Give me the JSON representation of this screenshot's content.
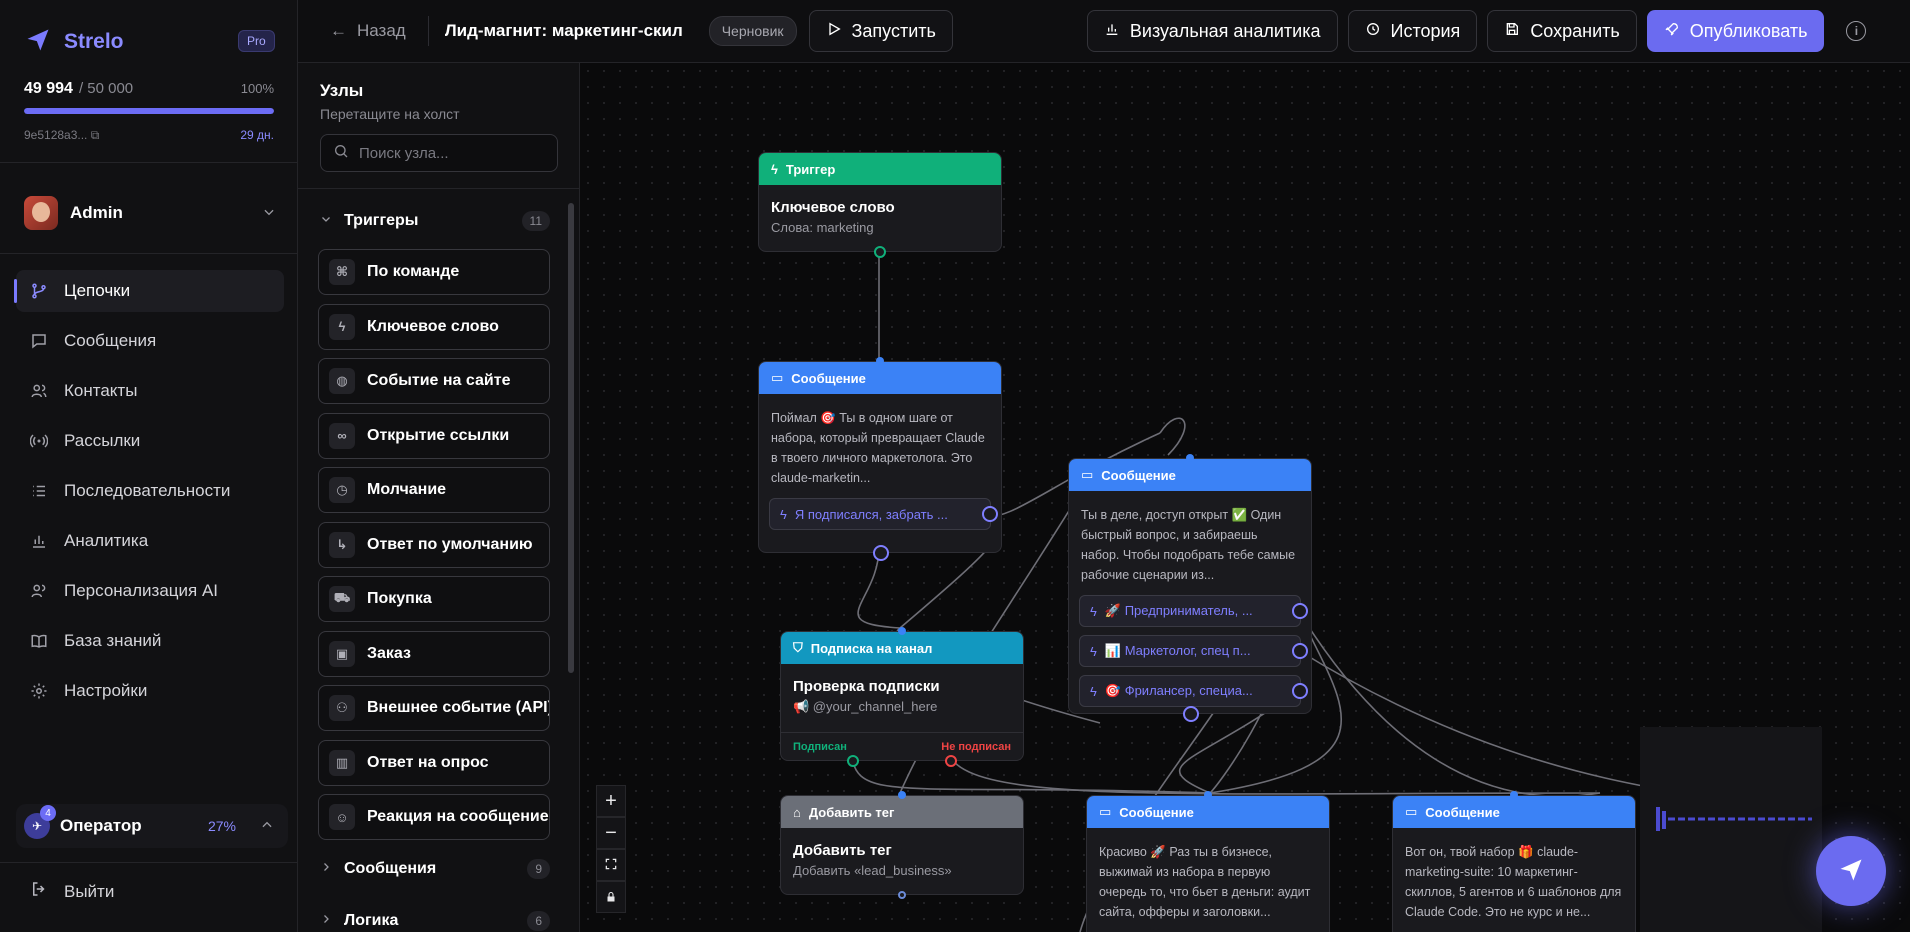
{
  "brand": {
    "name": "Strelo",
    "plan": "Pro"
  },
  "credits": {
    "used": "49 994",
    "max": "/ 50 000",
    "percent": "100%",
    "fill": 0.9999,
    "token": "9e5128a3...",
    "days": "29 дн."
  },
  "user": {
    "name": "Admin"
  },
  "nav": [
    {
      "label": "Цепочки",
      "icon": "branch-icon",
      "active": true
    },
    {
      "label": "Сообщения",
      "icon": "chat-icon"
    },
    {
      "label": "Контакты",
      "icon": "users-icon"
    },
    {
      "label": "Рассылки",
      "icon": "broadcast-icon"
    },
    {
      "label": "Последовательности",
      "icon": "list-icon"
    },
    {
      "label": "Аналитика",
      "icon": "bar-chart-icon"
    },
    {
      "label": "Персонализация AI",
      "icon": "user-ai-icon"
    },
    {
      "label": "База знаний",
      "icon": "book-icon"
    },
    {
      "label": "Настройки",
      "icon": "gear-icon"
    }
  ],
  "operator": {
    "label": "Оператор",
    "badge": "4",
    "percent": "27%"
  },
  "logout": "Выйти",
  "topbar": {
    "back": "Назад",
    "title": "Лид-магнит: маркетинг-скил",
    "status": "Черновик",
    "run": "Запустить",
    "analytics": "Визуальная аналитика",
    "history": "История",
    "save": "Сохранить",
    "publish": "Опубликовать"
  },
  "panel": {
    "title": "Узлы",
    "subtitle": "Перетащите на холст",
    "search_placeholder": "Поиск узла...",
    "groups": [
      {
        "label": "Триггеры",
        "count": "11",
        "expanded": true
      },
      {
        "label": "Сообщения",
        "count": "9"
      },
      {
        "label": "Логика",
        "count": "6"
      }
    ],
    "trigger_nodes": [
      {
        "label": "По команде",
        "icon": "command-icon"
      },
      {
        "label": "Ключевое слово",
        "icon": "bolt-icon"
      },
      {
        "label": "Событие на сайте",
        "icon": "globe-icon"
      },
      {
        "label": "Открытие ссылки",
        "icon": "link-icon"
      },
      {
        "label": "Молчание",
        "icon": "clock-icon"
      },
      {
        "label": "Ответ по умолчанию",
        "icon": "reply-icon"
      },
      {
        "label": "Покупка",
        "icon": "cart-icon"
      },
      {
        "label": "Заказ",
        "icon": "box-icon"
      },
      {
        "label": "Внешнее событие (API)",
        "icon": "webhook-icon"
      },
      {
        "label": "Ответ на опрос",
        "icon": "poll-icon"
      },
      {
        "label": "Реакция на сообщение",
        "icon": "smile-icon"
      }
    ]
  },
  "flow": {
    "trigger": {
      "header": "Триггер",
      "title": "Ключевое слово",
      "sub": "Слова: marketing"
    },
    "msg1": {
      "header": "Сообщение",
      "text": "Поймал 🎯 Ты в одном шаге от набора, который превращает Claude в твоего личного маркетолога. Это claude-marketin...",
      "button": "Я подписался, забрать ..."
    },
    "msg2": {
      "header": "Сообщение",
      "text": "Ты в деле, доступ открыт ✅ Один быстрый вопрос, и забираешь набор. Чтобы подобрать тебе самые рабочие сценарии из...",
      "buttons": [
        "🚀 Предприниматель, ...",
        "📊 Маркетолог, спец п...",
        "🎯 Фрилансер, специа..."
      ]
    },
    "sub": {
      "header": "Подписка на канал",
      "title": "Проверка подписки",
      "sub": "📢 @your_channel_here",
      "yes": "Подписан",
      "no": "Не подписан"
    },
    "tag": {
      "header": "Добавить тег",
      "title": "Добавить тег",
      "sub": "Добавить «lead_business»"
    },
    "msg3": {
      "header": "Сообщение",
      "text": "Красиво 🚀 Раз ты в бизнесе, выжимай из набора в первую очередь то, что бьет в деньги: аудит сайта, офферы и заголовки..."
    },
    "msg4": {
      "header": "Сообщение",
      "text": "Вот он, твой набор 🎁 claude-marketing-suite: 10 маркетинг-скиллов, 5 агентов и 6 шаблонов для Claude Code. Это не курс и не..."
    }
  }
}
